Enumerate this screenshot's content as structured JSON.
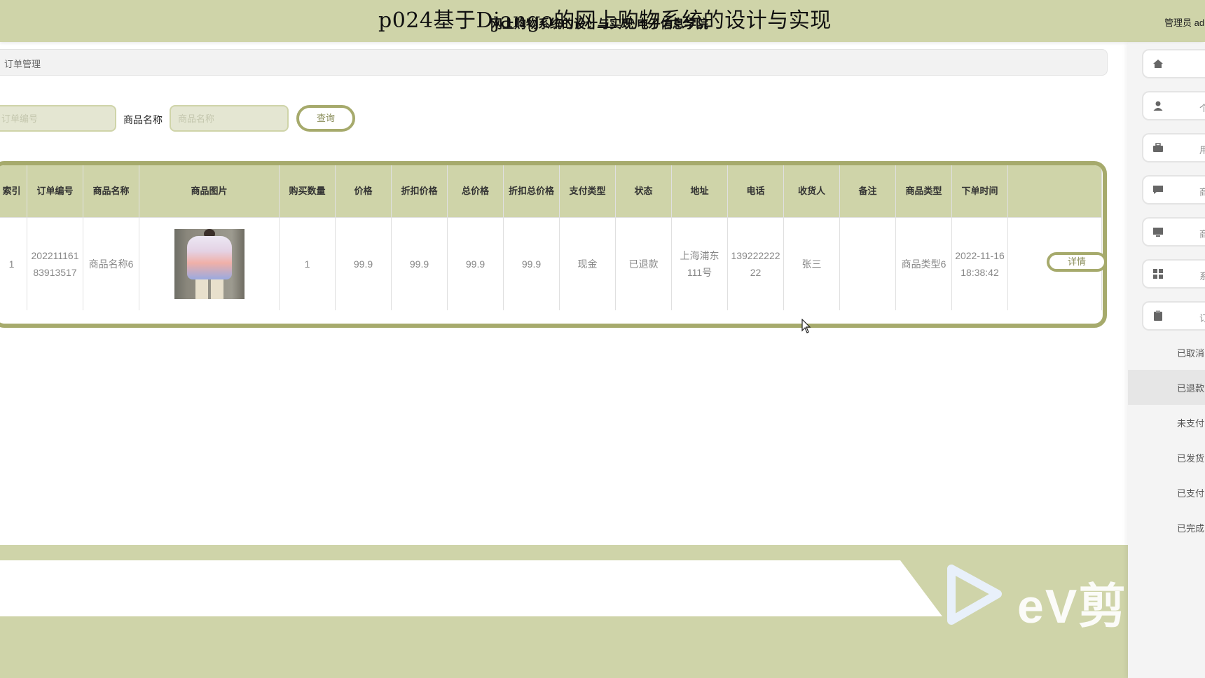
{
  "header": {
    "overlay_title": "p024基于Django的网上购物系统的设计与实现",
    "site_title": "网上购物系统的设计与实现 电子信息学院",
    "admin_label": "管理员 adr"
  },
  "breadcrumb": {
    "current": "订单管理"
  },
  "search": {
    "order_no_placeholder": "订单编号",
    "product_name_label": "商品名称",
    "product_name_placeholder": "商品名称",
    "query_button": "查询"
  },
  "table": {
    "columns": [
      "索引",
      "订单编号",
      "商品名称",
      "商品图片",
      "购买数量",
      "价格",
      "折扣价格",
      "总价格",
      "折扣总价格",
      "支付类型",
      "状态",
      "地址",
      "电话",
      "收货人",
      "备注",
      "商品类型",
      "下单时间"
    ],
    "rows": [
      {
        "index": "1",
        "order_no": "20221116183913517",
        "product_name": "商品名称6",
        "quantity": "1",
        "price": "99.9",
        "discount_price": "99.9",
        "total_price": "99.9",
        "discount_total": "99.9",
        "pay_type": "现金",
        "status": "已退款",
        "address": "上海浦东111号",
        "phone": "13922222222",
        "receiver": "张三",
        "remark": "",
        "product_type": "商品类型6",
        "order_time": "2022-11-16 18:38:42",
        "detail_button": "详情"
      }
    ]
  },
  "sidebar": {
    "items": [
      {
        "icon": "home-icon",
        "label": ""
      },
      {
        "icon": "user-icon",
        "label": "个"
      },
      {
        "icon": "briefcase-icon",
        "label": "用"
      },
      {
        "icon": "comment-icon",
        "label": "商品"
      },
      {
        "icon": "monitor-icon",
        "label": "商品"
      },
      {
        "icon": "grid-icon",
        "label": "系"
      },
      {
        "icon": "clipboard-icon",
        "label": "订"
      }
    ],
    "sub_items": [
      "已取消",
      "已退款",
      "未支付",
      "已发货",
      "已支付",
      "已完成"
    ],
    "active_sub": "已退款"
  },
  "watermark": {
    "text": "eV剪辑",
    "brand_color": "#ffffff"
  },
  "colors": {
    "accent": "#cfd4a9",
    "accent_dark": "#a6aa6c"
  }
}
